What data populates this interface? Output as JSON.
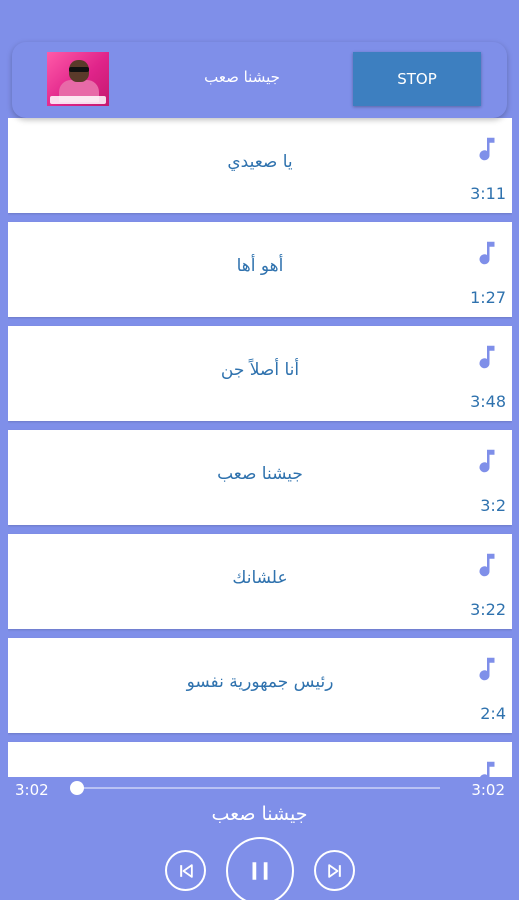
{
  "top_bar": {
    "title": "جيشنا صعب",
    "stop_label": "STOP",
    "thumbnail_icon": "album-art-icon"
  },
  "songs": [
    {
      "title": "يا صعيدي",
      "duration": "3:11"
    },
    {
      "title": "أهو أها",
      "duration": "1:27"
    },
    {
      "title": "أنا أصلاً جن",
      "duration": "3:48"
    },
    {
      "title": "جيشنا صعب",
      "duration": "3:2"
    },
    {
      "title": "علشانك",
      "duration": "3:22"
    },
    {
      "title": "رئيس جمهورية نفسو",
      "duration": "2:4"
    },
    {
      "title": "",
      "duration": ""
    }
  ],
  "player": {
    "current_time": "3:02",
    "total_time": "3:02",
    "title": "جيشنا صعب",
    "progress_fraction": 0.0
  },
  "colors": {
    "background": "#7f8fe9",
    "accent_text": "#2f72ae",
    "stop_button": "#3d7fc0",
    "note_icon": "#7f8fe9"
  }
}
